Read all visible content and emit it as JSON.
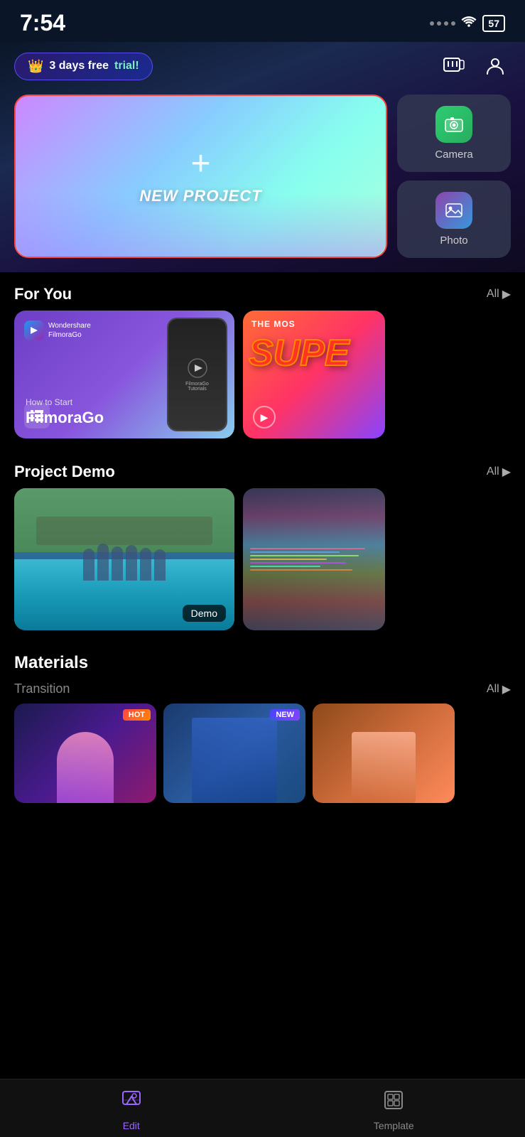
{
  "statusBar": {
    "time": "7:54",
    "battery": "57"
  },
  "header": {
    "trialBadge": {
      "crown": "👑",
      "freeText": "3 days free",
      "trialText": "trial!"
    },
    "icons": {
      "video": "▶",
      "profile": "👤"
    }
  },
  "newProject": {
    "plus": "+",
    "label": "NEW PROJECT"
  },
  "sideButtons": [
    {
      "id": "camera",
      "label": "Camera",
      "icon": "📷"
    },
    {
      "id": "photo",
      "label": "Photo",
      "icon": "🖼"
    }
  ],
  "forYou": {
    "title": "For You",
    "allLabel": "All",
    "cards": [
      {
        "id": "tutorial",
        "logoText": "Wondershare\nFilmoraGo",
        "titleSmall": "How to Start",
        "titleMain": "FilmoraGo",
        "phoneText": "FilmoraGo\nTutorials"
      },
      {
        "id": "super",
        "topText": "THE MOS",
        "mainText": "SUPE"
      }
    ]
  },
  "projectDemo": {
    "title": "Project Demo",
    "allLabel": "All",
    "cards": [
      {
        "id": "pool",
        "badge": "Demo"
      },
      {
        "id": "rainbow",
        "badge": ""
      }
    ]
  },
  "materials": {
    "title": "Materials",
    "transition": {
      "title": "Transition",
      "allLabel": "All"
    },
    "cards": [
      {
        "id": "hot-girl",
        "badge": "HOT",
        "badgeType": "hot"
      },
      {
        "id": "new-blue",
        "badge": "NEW",
        "badgeType": "new"
      },
      {
        "id": "pink-card",
        "badge": "",
        "badgeType": ""
      }
    ]
  },
  "bottomNav": {
    "items": [
      {
        "id": "edit",
        "label": "Edit",
        "icon": "edit",
        "active": true
      },
      {
        "id": "template",
        "label": "Template",
        "icon": "template",
        "active": false
      }
    ]
  }
}
